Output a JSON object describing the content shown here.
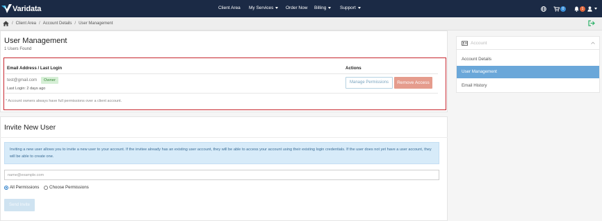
{
  "brand": {
    "name": "Varidata"
  },
  "nav": {
    "items": [
      "Client Area",
      "My Services",
      "Order Now",
      "Billing",
      "Support"
    ],
    "cart_count": "0",
    "notifications_count": "1"
  },
  "breadcrumb": [
    "Client Area",
    "Account Details",
    "User Management"
  ],
  "users": {
    "title": "User Management",
    "count_text": "1 Users Found",
    "col_email": "Email Address / Last Login",
    "col_actions": "Actions",
    "rows": [
      {
        "email": "test@gmail.com",
        "role": "Owner",
        "last_login": "Last Login: 2 days ago"
      }
    ],
    "manage_label": "Manage Permissions",
    "remove_label": "Remove Access",
    "note": "* Account owners always have full permissions over a client account."
  },
  "invite": {
    "title": "Invite New User",
    "info": "Inviting a new user allows you to invite a new user to your account. If the invitee already has an existing user account, they will be able to access your account using their existing login credentials. If the user does not yet have a user account, they will be able to create one.",
    "email_placeholder": "name@example.com",
    "perm_all": "All Permissions",
    "perm_choose": "Choose Permissions",
    "button": "Send Invite"
  },
  "sidebar": {
    "heading": "Account",
    "items": [
      "Account Details",
      "User Management",
      "Email History"
    ],
    "active_index": 1
  },
  "colors": {
    "navbar": "#1b2a45",
    "highlight_border": "#c6262e",
    "active_item": "#6aa7d9",
    "remove_button": "#e59c8d",
    "owner_badge": "#d6efd6"
  }
}
